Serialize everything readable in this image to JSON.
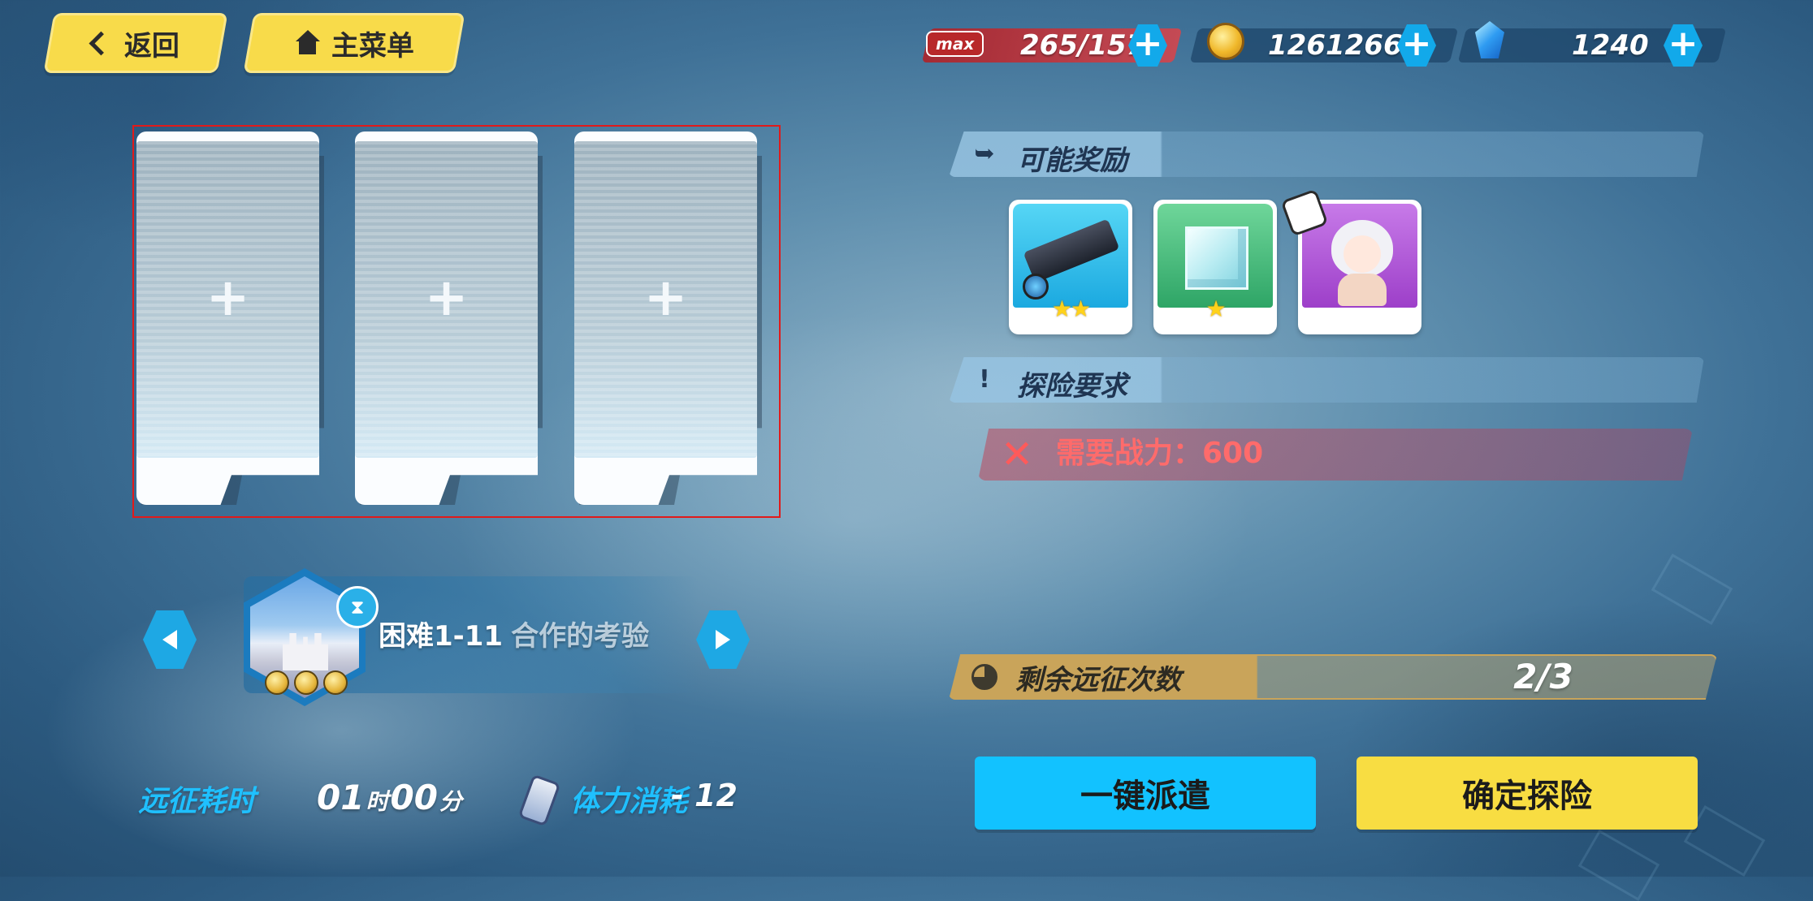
{
  "nav": {
    "back_label": "返回",
    "main_menu_label": "主菜单"
  },
  "resources": {
    "stamina": {
      "tag": "max",
      "value": "265/157"
    },
    "coins": {
      "value": "12612666"
    },
    "crystals": {
      "value": "1240"
    },
    "plus_symbol": "+"
  },
  "slots": [
    {
      "label": "+"
    },
    {
      "label": "+"
    },
    {
      "label": "+"
    }
  ],
  "stage": {
    "name": "困难1-11",
    "subtitle": "合作的考验",
    "medals": 3
  },
  "expedition": {
    "time_label": "远征耗时",
    "hours": "01",
    "hours_unit": "时",
    "minutes": "00",
    "minutes_unit": "分",
    "stamina_label": "体力消耗",
    "stamina_cost": "- 12"
  },
  "rewards": {
    "title": "可能奖励",
    "items": [
      {
        "name": "weapon",
        "stars": "★★",
        "color": "#2fc3ea"
      },
      {
        "name": "crystal-cube",
        "stars": "★",
        "color": "#3fbf7a"
      },
      {
        "name": "character-fragment",
        "stars": "",
        "color": "#b35ed8"
      }
    ]
  },
  "requirements": {
    "title": "探险要求",
    "power_text": "需要战力：600",
    "status": "unmet"
  },
  "remaining": {
    "label": "剩余远征次数",
    "value": "2/3"
  },
  "actions": {
    "dispatch_label": "一键派遣",
    "confirm_label": "确定探险"
  }
}
